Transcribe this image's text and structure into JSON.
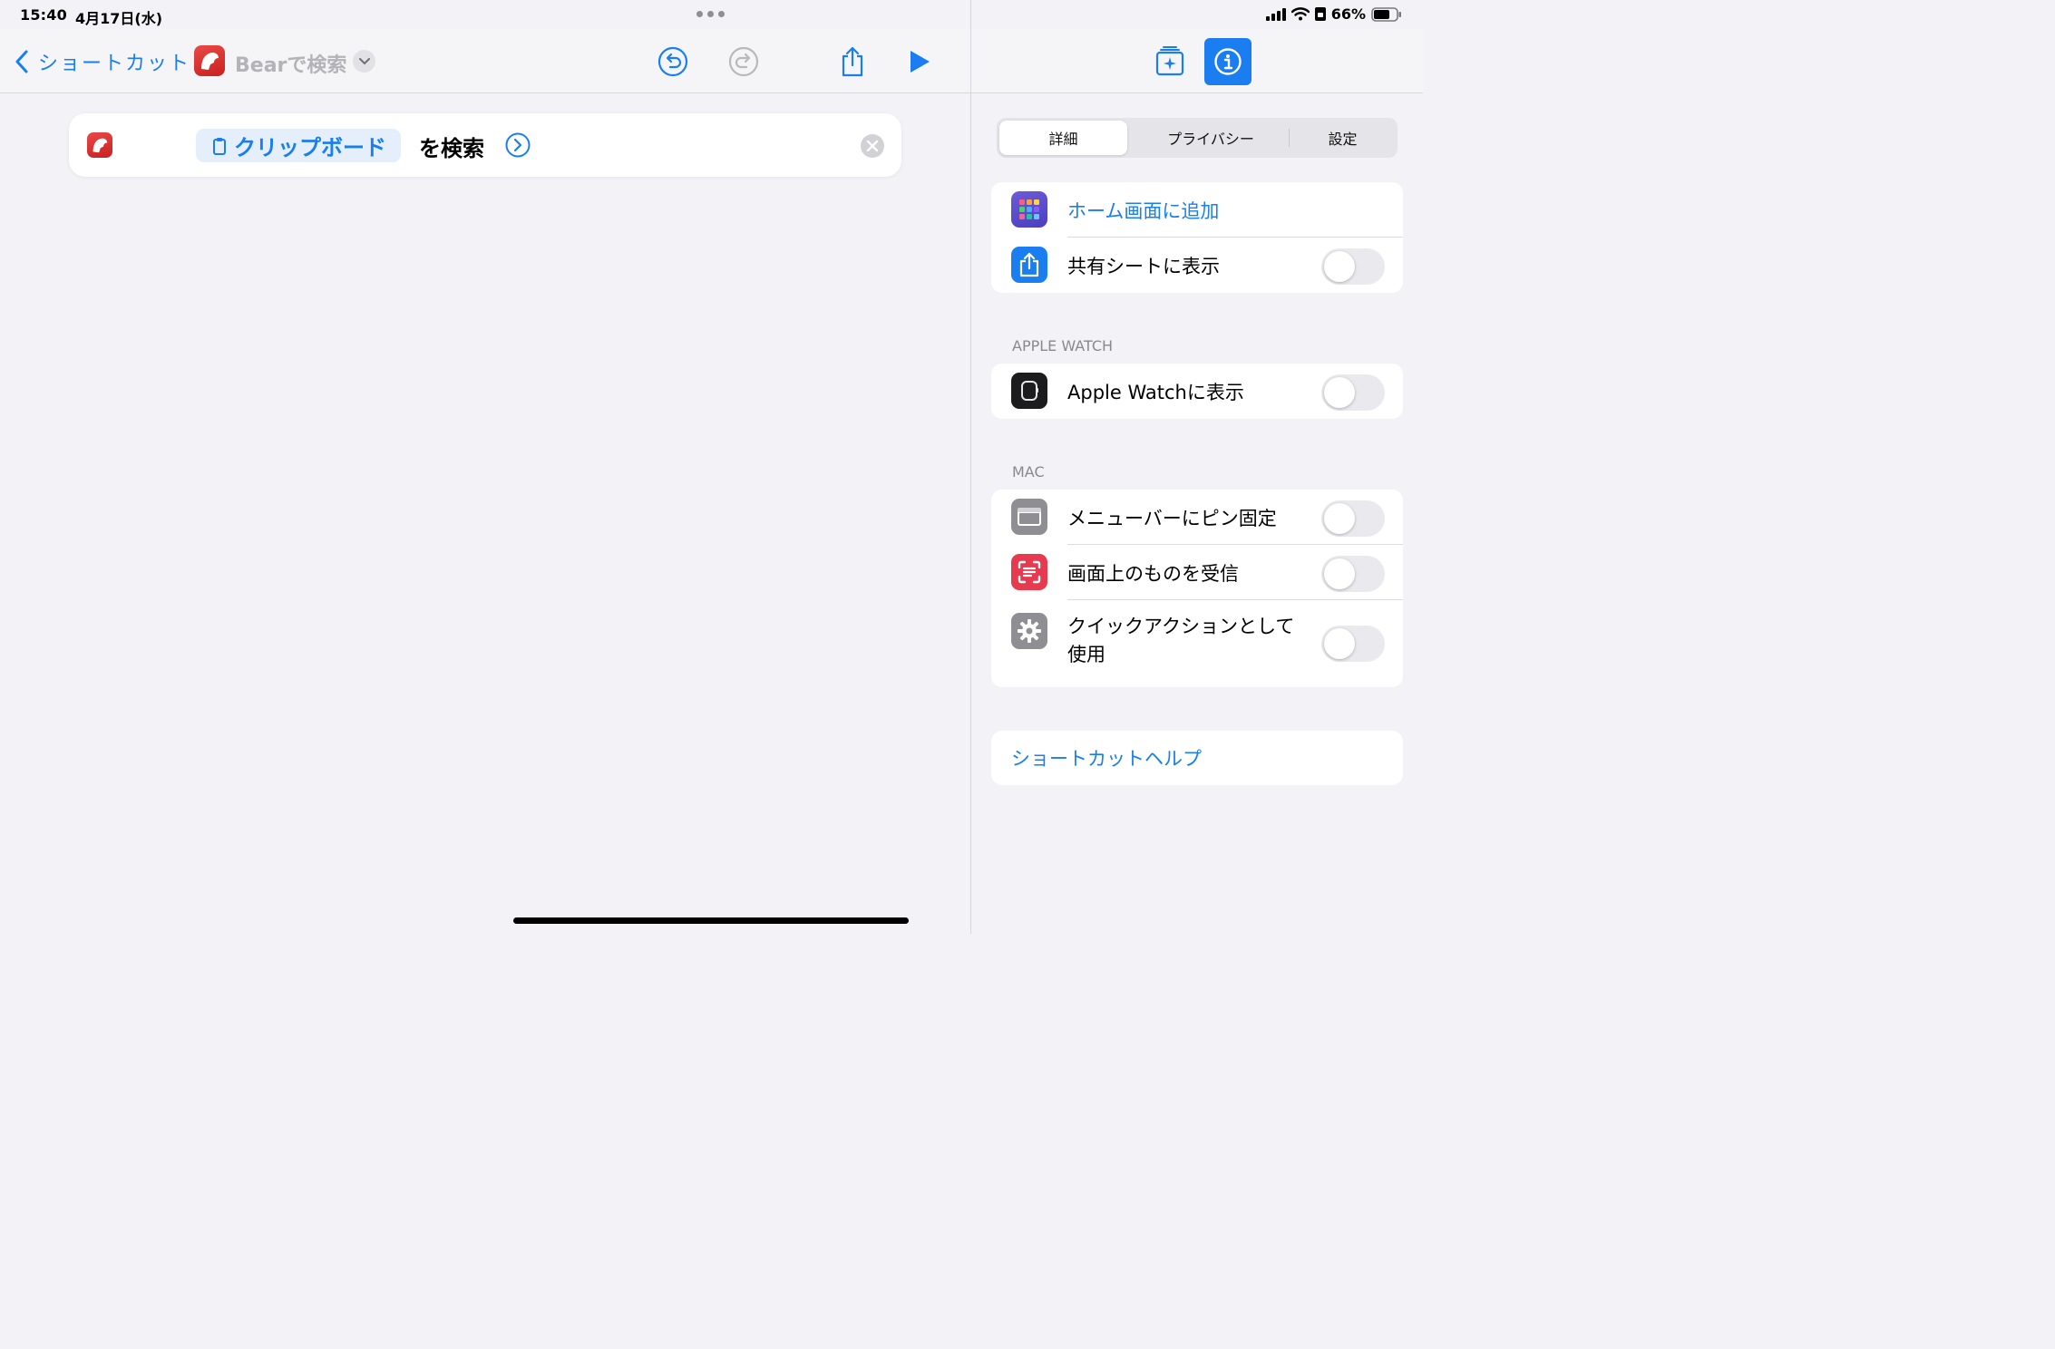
{
  "status": {
    "time": "15:40",
    "date": "4月17日(水)",
    "battery": "66%"
  },
  "toolbar": {
    "back_label": "ショートカット",
    "title": "Bearで検索"
  },
  "action": {
    "token_label": "クリップボード",
    "text": "を検索"
  },
  "inspector": {
    "tabs": [
      {
        "label": "詳細"
      },
      {
        "label": "プライバシー"
      },
      {
        "label": "設定"
      }
    ],
    "general": {
      "add_home": "ホーム画面に追加",
      "share_sheet": "共有シートに表示"
    },
    "apple_watch": {
      "header": "APPLE WATCH",
      "show": "Apple Watchに表示"
    },
    "mac": {
      "header": "MAC",
      "menubar": "メニューバーにピン固定",
      "onscreen": "画面上のものを受信",
      "quick_action_line1": "クイックアクションとして",
      "quick_action_line2": "使用"
    },
    "help": "ショートカットヘルプ"
  },
  "colors": {
    "accent": "#1a7ef0",
    "bear_red": "#d9302d",
    "screen_red": "#e73a4e",
    "watch_black": "#1c1c1e",
    "gray_icon": "#8e8e93",
    "purple_icon": "#5856d6"
  },
  "toggles": {
    "share_sheet": false,
    "apple_watch": false,
    "menubar": false,
    "onscreen": false,
    "quick_action": false
  }
}
